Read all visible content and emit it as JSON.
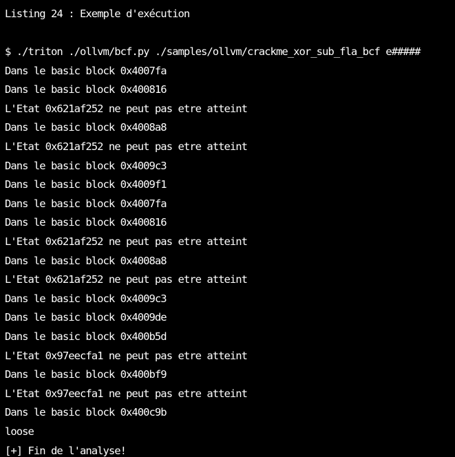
{
  "listing_title": "Listing 24 : Exemple d'exécution",
  "command": "$ ./triton ./ollvm/bcf.py ./samples/ollvm/crackme_xor_sub_fla_bcf e#####",
  "output_lines": [
    "Dans le basic block 0x4007fa",
    "Dans le basic block 0x400816",
    "L'Etat 0x621af252 ne peut pas etre atteint",
    "Dans le basic block 0x4008a8",
    "L'Etat 0x621af252 ne peut pas etre atteint",
    "Dans le basic block 0x4009c3",
    "Dans le basic block 0x4009f1",
    "Dans le basic block 0x4007fa",
    "Dans le basic block 0x400816",
    "L'Etat 0x621af252 ne peut pas etre atteint",
    "Dans le basic block 0x4008a8",
    "L'Etat 0x621af252 ne peut pas etre atteint",
    "Dans le basic block 0x4009c3",
    "Dans le basic block 0x4009de",
    "Dans le basic block 0x400b5d",
    "L'Etat 0x97eecfa1 ne peut pas etre atteint",
    "Dans le basic block 0x400bf9",
    "L'Etat 0x97eecfa1 ne peut pas etre atteint",
    "Dans le basic block 0x400c9b",
    "loose",
    "[+] Fin de l'analyse!"
  ]
}
